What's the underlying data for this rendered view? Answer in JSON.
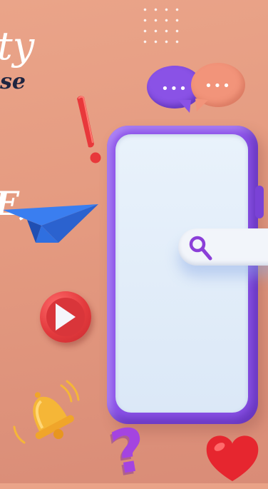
{
  "partial_text": {
    "top_script": "ty",
    "sub_script": "se",
    "side_text": "E,"
  },
  "icons": {
    "chat_bubble_1": "speech-bubble-dots",
    "chat_bubble_2": "speech-bubble-dots",
    "exclamation": "exclamation-mark",
    "paper_plane": "paper-plane",
    "play_button": "play-circle",
    "bell": "notification-bell",
    "question": "question-mark",
    "heart": "heart",
    "search": "magnifying-glass",
    "phone": "smartphone"
  },
  "bubble_dots": "•••",
  "question_glyph": "?",
  "colors": {
    "background": "#e49a80",
    "phone": "#8b52e8",
    "screen": "#e9f2fb",
    "accent_red": "#e33a3d",
    "plane_blue": "#2f6fe0",
    "bell_yellow": "#f5b637",
    "question_purple": "#a444e0"
  }
}
